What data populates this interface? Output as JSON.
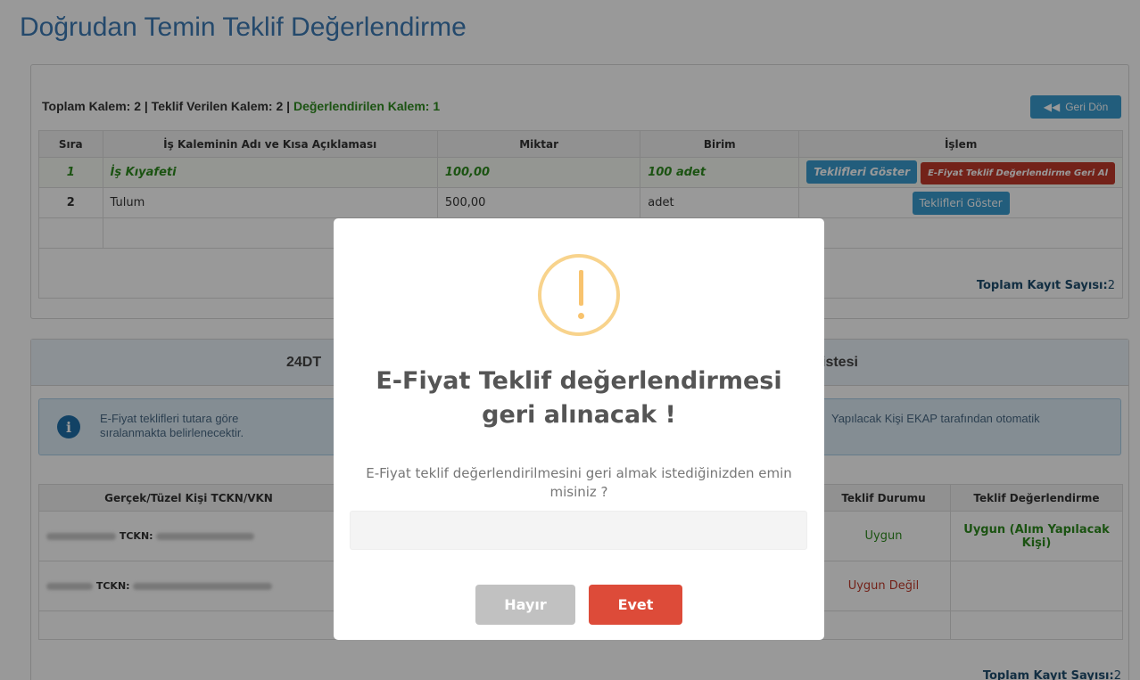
{
  "page": {
    "title": "Doğrudan Temin Teklif Değerlendirme"
  },
  "summary": {
    "text_main": "Toplam Kalem: 2 | Teklif Verilen Kalem: 2 | ",
    "text_green": "Değerlendirilen Kalem: 1"
  },
  "back_button": {
    "label": "Geri Dön",
    "icon": "double-chevron-left-icon"
  },
  "items_table": {
    "headers": [
      "Sıra",
      "İş Kaleminin Adı ve Kısa Açıklaması",
      "Miktar",
      "Birim",
      "İşlem"
    ],
    "rows": [
      {
        "sira": "1",
        "ad": "İş Kıyafeti",
        "miktar": "100,00",
        "birim": "100 adet",
        "btn_show": "Teklifleri Göster",
        "btn_revert": "E-Fiyat Teklif Değerlendirme Geri Al"
      },
      {
        "sira": "2",
        "ad": "Tulum",
        "miktar": "500,00",
        "birim": "adet",
        "btn_show": "Teklifleri Göster"
      }
    ],
    "total_label": "Toplam Kayıt Sayısı:",
    "total_value": "2"
  },
  "offers_panel": {
    "title_left": "24DT",
    "title_right": "istesi",
    "info_left": "E-Fiyat teklifleri tutara göre sıralanmakta belirlenecektir.",
    "info_right": "Yapılacak Kişi EKAP tarafından otomatik",
    "headers": [
      "Gerçek/Tüzel Kişi TCKN/VKN",
      "Teklif Durumu",
      "Teklif Değerlendirme"
    ],
    "rows": [
      {
        "tckn_label": "TCKN:",
        "durum": "Uygun",
        "degerlendirme": "Uygun (Alım Yapılacak Kişi)"
      },
      {
        "tckn_label": "TCKN:",
        "durum": "Uygun Değil",
        "degerlendirme": ""
      }
    ],
    "total_label": "Toplam Kayıt Sayısı:",
    "total_value": "2"
  },
  "modal": {
    "icon": "warning-icon",
    "title": "E-Fiyat Teklif değerlendirmesi geri alınacak !",
    "text": "E-Fiyat teklif değerlendirilmesini geri almak istediğinizden emin misiniz ?",
    "input_value": "",
    "no_label": "Hayır",
    "yes_label": "Evet"
  },
  "colors": {
    "accent": "#3a9ccf",
    "danger": "#dd4b39",
    "success": "#2e8b1e",
    "warning": "#f8c36e"
  }
}
